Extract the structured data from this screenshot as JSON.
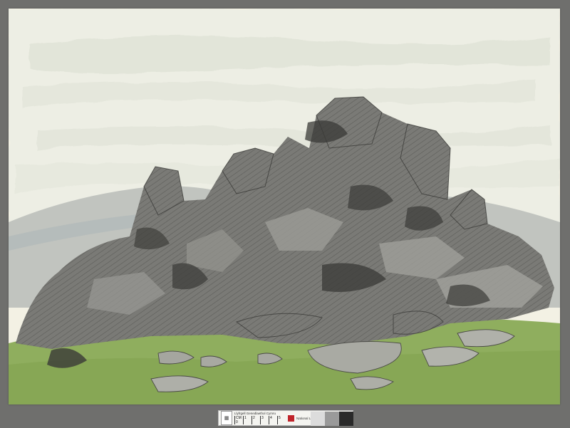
{
  "artwork": {
    "medium": "watercolour and pencil",
    "colors": {
      "sky": "#ecede2",
      "hill": "#b9bdb7",
      "rock": "#6f6f6b",
      "grass": "#8fae5e",
      "paper": "#f3f1e4",
      "mount": "#6f6f6d"
    }
  },
  "colour_target": {
    "institution_welsh": "Llyfrgell Genedlaethol Cymru",
    "institution_english": "National Library of Wales",
    "scale_labels": [
      "CM 0",
      "1",
      "2",
      "3",
      "4",
      "5"
    ],
    "swatch_colors": [
      "#dcdcdc",
      "#9a9a9a",
      "#2a2a2a"
    ]
  }
}
